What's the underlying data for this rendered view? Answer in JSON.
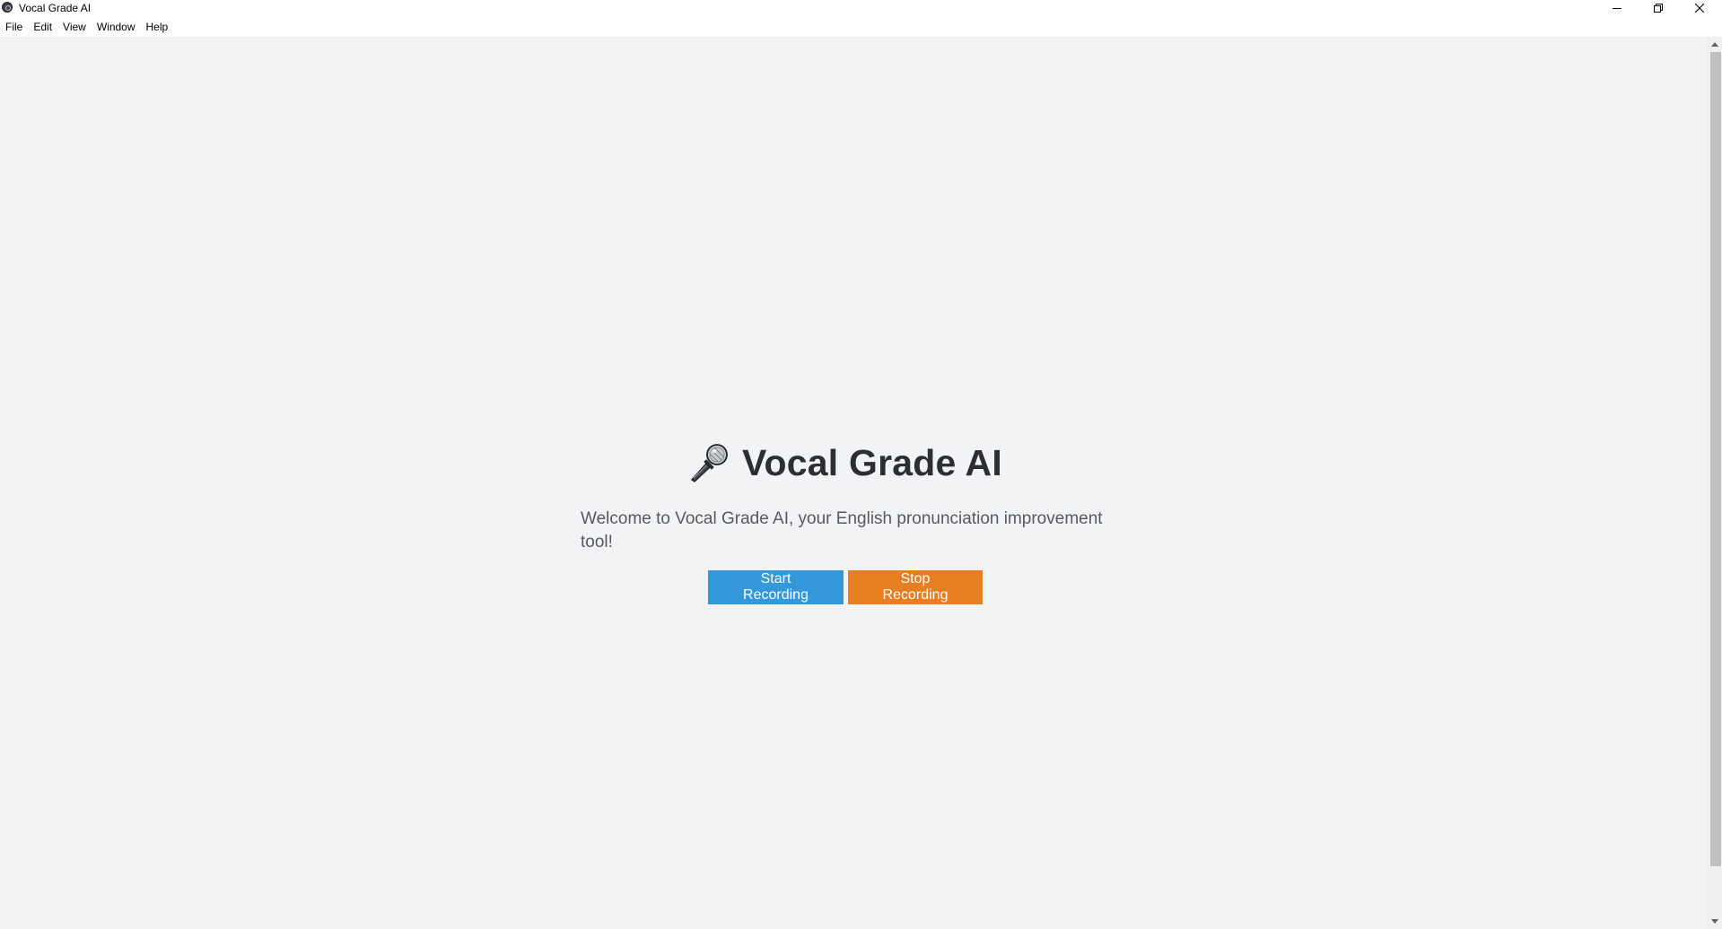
{
  "window": {
    "title": "Vocal Grade AI"
  },
  "menu": {
    "items": [
      "File",
      "Edit",
      "View",
      "Window",
      "Help"
    ]
  },
  "main": {
    "heading": "Vocal Grade AI",
    "heading_icon": "microphone-icon",
    "welcome_text": "Welcome to Vocal Grade AI, your English pronunciation improvement tool!",
    "start_button_label": "Start Recording",
    "stop_button_label": "Stop Recording"
  },
  "colors": {
    "start_button": "#3498db",
    "stop_button": "#e67e22",
    "background": "#f2f3f5",
    "heading_text": "#2b2f33"
  }
}
